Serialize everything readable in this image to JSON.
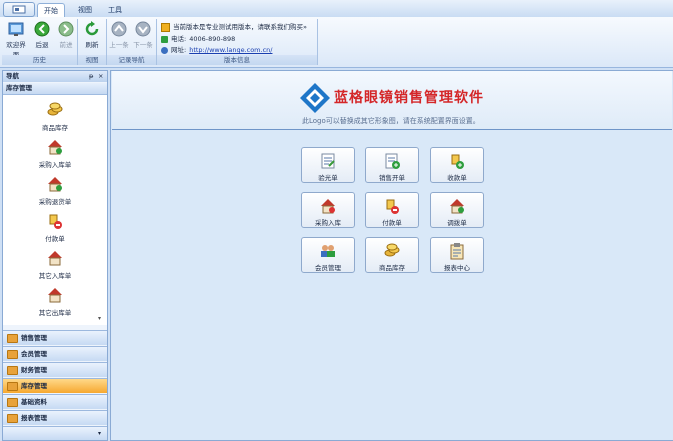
{
  "ribbon": {
    "tabs": [
      "开始",
      "视图",
      "工具"
    ],
    "active_tab": "开始",
    "groups": {
      "history": {
        "label": "历史",
        "buttons": [
          "欢迎界面",
          "后退",
          "前进"
        ]
      },
      "view": {
        "label": "视图",
        "buttons": [
          "刷新"
        ]
      },
      "records": {
        "label": "记录导航",
        "buttons": [
          "上一条",
          "下一条"
        ]
      },
      "version": {
        "label": "版本信息",
        "notice": "当前版本是专业测试用版本，请联系我们购买»",
        "phone_label": "电话:",
        "phone": "4006-890-898",
        "site_label": "网址:",
        "site": "http://www.lange.com.cn/"
      }
    }
  },
  "nav": {
    "title": "导航",
    "pin": "ᵽ",
    "close": "×",
    "category": "库存管理",
    "items": [
      "商品库存",
      "采购入库单",
      "采购退货单",
      "付款单",
      "其它入库单",
      "其它出库单"
    ],
    "accordion": [
      {
        "label": "销售管理",
        "active": false
      },
      {
        "label": "会员管理",
        "active": false
      },
      {
        "label": "财务管理",
        "active": false
      },
      {
        "label": "库存管理",
        "active": true
      },
      {
        "label": "基础资料",
        "active": false
      },
      {
        "label": "报表管理",
        "active": false
      }
    ]
  },
  "main": {
    "title": "蓝格眼镜销售管理软件",
    "subtitle": "此Logo可以替换成其它形象图，请在系统配置界面设置。",
    "tiles": [
      "验光单",
      "销售开单",
      "收款单",
      "采购入库",
      "付款单",
      "调拨单",
      "会员管理",
      "商品库存",
      "报表中心"
    ]
  },
  "colors": {
    "accent": "#d42628",
    "active_nav": "#f6a830",
    "ribbon": "#dbe8f8"
  }
}
